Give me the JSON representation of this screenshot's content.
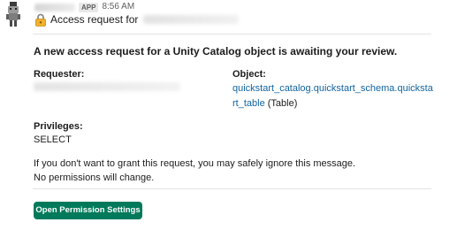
{
  "message": {
    "app_badge": "APP",
    "timestamp": "8:56 AM",
    "title": "Access request for"
  },
  "body": {
    "intro": "A new access request for a Unity Catalog object is awaiting your review.",
    "requester_label": "Requester:",
    "object_label": "Object:",
    "object_link": "quickstart_catalog.quickstart_schema.quickstart_table",
    "object_suffix": " (Table)",
    "privileges_label": "Privileges:",
    "privileges_value": "SELECT",
    "footer_line1": "If you don't want to grant this request, you may safely ignore this message.",
    "footer_line2": "No permissions will change."
  },
  "actions": {
    "open_settings_label": "Open Permission Settings"
  },
  "colors": {
    "button_bg": "#007a5a",
    "link": "#1264a3",
    "text": "#1d1c1d",
    "muted": "#616061"
  },
  "icons": {
    "avatar": "robot-avatar-icon",
    "title": "lock-icon"
  }
}
